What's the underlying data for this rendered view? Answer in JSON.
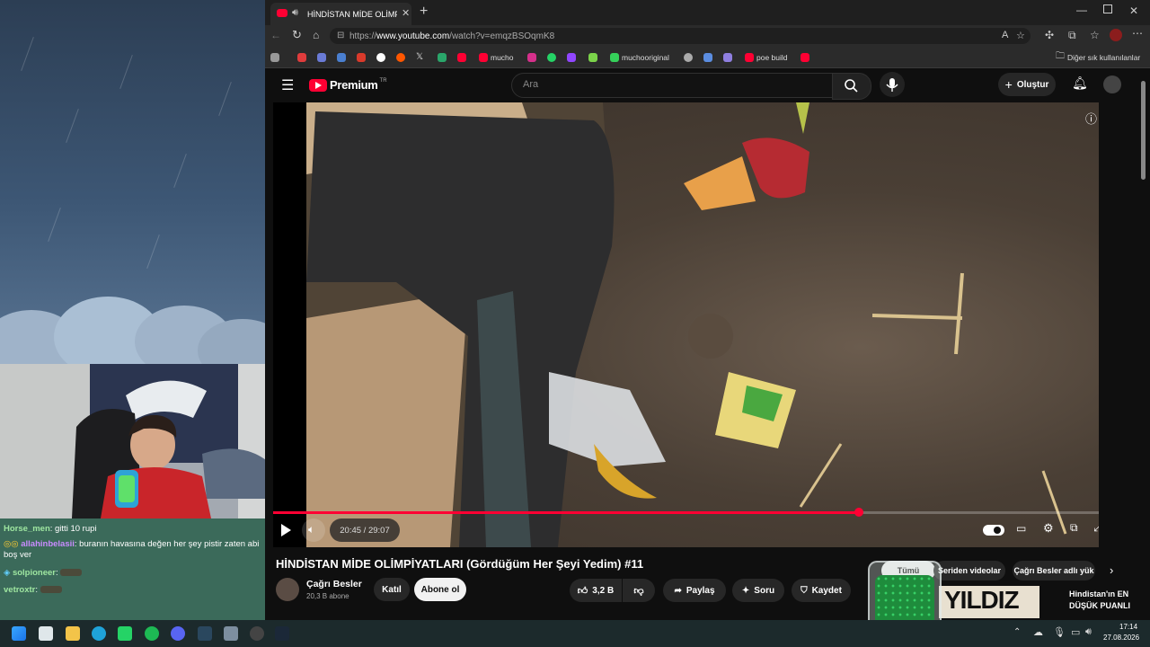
{
  "browser": {
    "tab_title": "HİNDİSTAN MİDE OLİMPİYATI",
    "url_prefix": "https://",
    "url_host": "www.youtube.com",
    "url_path": "/watch?v=emqzBSOqmK8",
    "bookmarks": [
      "mucho",
      "muchooriginal",
      "poe build"
    ],
    "other_bookmarks": "Diğer sık kullanılanlar"
  },
  "youtube": {
    "logo_text": "Premium",
    "logo_region": "TR",
    "search_placeholder": "Ara",
    "create_label": "Oluştur",
    "video": {
      "time_current": "20:45",
      "time_sep": " / ",
      "time_total": "29:07",
      "progress": 0.71
    },
    "title": "HİNDİSTAN MİDE OLİMPİYATLARI (Gördüğüm Her Şeyi Yedim) #11",
    "channel_name": "Çağrı Besler",
    "subscribers": "20,3 B abone",
    "join_label": "Katıl",
    "subscribe_label": "Abone ol",
    "likes": "3,2 B",
    "share_label": "Paylaş",
    "ask_label": "Soru",
    "save_label": "Kaydet",
    "chips": [
      "Tümü",
      "Seriden videolar",
      "Çağrı Besler adlı yük"
    ],
    "side_video_title_line1": "Hindistan'ın EN",
    "side_video_title_line2": "DÜŞÜK PUANLI",
    "side_thumb_text": "YILDIZ"
  },
  "chat": [
    {
      "name": "Horse_men",
      "text": ": gitti 10 rupi",
      "color": "#9ee6a0"
    },
    {
      "name": "allahinbelasii",
      "text": ": buranın havasına değen her şey pistir zaten abi boş ver",
      "color": "#c98bff"
    },
    {
      "name": "solpioneer",
      "text": ":",
      "color": "#9ee6a0"
    },
    {
      "name": "vetroxtr",
      "text": ":",
      "color": "#9ee6a0"
    }
  ],
  "taskbar": {
    "time": "17:14",
    "date": "27.08.2026"
  },
  "colors": {
    "youtube_red": "#ff0033",
    "progress_red": "#ff0033",
    "taskbar_bg": "#1c2a2c"
  }
}
